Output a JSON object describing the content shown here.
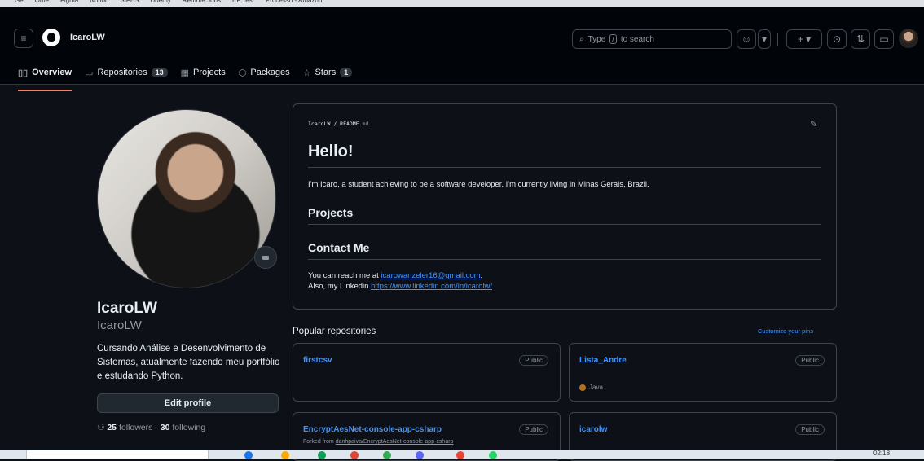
{
  "bookmarks": [
    "Ge",
    "Ome",
    "Figma",
    "Notion",
    "SIFES",
    "Udemy",
    "Remote Jobs",
    "EF Test",
    "Processo - Amazon"
  ],
  "header": {
    "username": "IcaroLW",
    "search_placeholder": "Type",
    "search_key": "/",
    "search_suffix": "to search"
  },
  "tabs": [
    {
      "label": "Overview",
      "icon": "book-icon"
    },
    {
      "label": "Repositories",
      "count": "13",
      "icon": "repo-icon"
    },
    {
      "label": "Projects",
      "icon": "table-icon"
    },
    {
      "label": "Packages",
      "icon": "package-icon"
    },
    {
      "label": "Stars",
      "count": "1",
      "icon": "star-icon"
    }
  ],
  "profile": {
    "name": "IcaroLW",
    "login": "IcaroLW",
    "bio": "Cursando Análise e Desenvolvimento de Sistemas, atualmente fazendo meu portfólio e estudando Python.",
    "edit_label": "Edit profile",
    "followers": "25",
    "followers_label": "followers",
    "following": "30",
    "following_label": "following"
  },
  "readme": {
    "user": "IcaroLW",
    "file": "README",
    "ext": ".md",
    "h1": "Hello!",
    "intro": "I'm Icaro, a student achieving to be a software developer. I'm currently living in Minas Gerais, Brazil.",
    "projects_heading": "Projects",
    "contact_heading": "Contact Me",
    "contact_prefix": "You can reach me at",
    "email": "icarowanzeler16@gmail.com",
    "linkedin_prefix": "Also, my Linkedin",
    "linkedin": "https://www.linkedin.com/in/icarolw/"
  },
  "popular": {
    "title": "Popular repositories",
    "customize": "Customize your pins",
    "repos": [
      {
        "name": "firstcsv",
        "visibility": "Public"
      },
      {
        "name": "Lista_Andre",
        "visibility": "Public",
        "language": "Java",
        "lang_color": "#b07219"
      },
      {
        "name": "EncryptAesNet-console-app-csharp",
        "visibility": "Public",
        "fork_prefix": "Forked from",
        "fork_source": "danhpaiva/EncryptAesNet-console-app-csharp"
      },
      {
        "name": "icarolw",
        "visibility": "Public"
      }
    ]
  },
  "taskbar": {
    "time": "02:18"
  }
}
